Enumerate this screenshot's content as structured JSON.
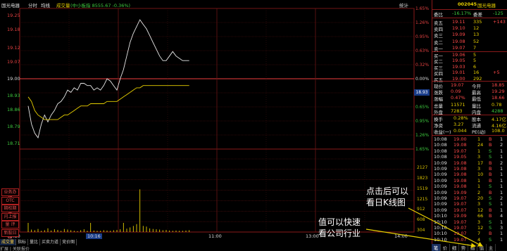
{
  "header": {
    "stock_name": "国光电器",
    "mode": "分时",
    "avg_label": "均线",
    "vol_label": "成交量",
    "index_text": "(中小板指 8555.67 -0.36%)",
    "stats_btn": "统计"
  },
  "price_axis": {
    "labels": [
      "19.25",
      "19.18",
      "19.12",
      "19.07",
      "19.00",
      "18.93",
      "18.86",
      "18.79",
      "18.71"
    ],
    "highlight": "18.93"
  },
  "pct_axis": [
    "1.65%",
    "1.26%",
    "0.95%",
    "0.63%",
    "0.32%",
    "0.00%",
    "0.32%",
    "0.65%",
    "0.95%",
    "1.26%",
    "1.65%"
  ],
  "vol_axis": [
    "2127",
    "1823",
    "1519",
    "1215",
    "912",
    "608",
    "304"
  ],
  "time_axis": [
    "09:30",
    "10:16",
    "11:00",
    "13:00",
    "14:00"
  ],
  "side_buttons": [
    "业务办理",
    "OTC",
    "期权期货",
    "闪上报价",
    "量  评",
    "新股日历"
  ],
  "bottom_tabs": [
    "成交量",
    "指标",
    "量比",
    "买卖力道",
    "竞价图"
  ],
  "bottom_row": "扩展 | 关联报价",
  "chart_data": {
    "type": "line",
    "x": [
      0,
      2,
      4,
      6,
      8,
      10,
      12,
      14,
      16,
      18,
      20,
      22,
      24,
      26,
      28,
      30,
      32,
      34,
      36,
      38,
      40,
      42,
      44,
      46,
      48,
      50,
      52,
      54,
      56,
      58,
      60,
      62,
      64,
      66,
      68,
      70,
      72,
      74,
      76,
      78,
      80,
      82,
      84,
      86,
      88,
      90,
      92,
      94,
      96,
      98
    ],
    "series": [
      {
        "values": [
          18.88,
          18.8,
          18.76,
          18.74,
          18.8,
          18.84,
          18.81,
          18.84,
          18.86,
          18.89,
          18.9,
          18.92,
          18.95,
          18.94,
          18.96,
          18.95,
          18.98,
          18.98,
          18.97,
          18.97,
          18.95,
          18.96,
          18.95,
          18.97,
          19.0,
          18.99,
          18.97,
          18.95,
          19.0,
          19.04,
          19.1,
          19.16,
          19.2,
          19.23,
          19.26,
          19.24,
          19.22,
          19.19,
          19.16,
          19.13,
          19.1,
          19.08,
          19.08,
          19.1,
          19.12,
          19.1,
          19.09,
          19.08,
          19.08,
          19.08
        ]
      },
      {
        "values": [
          18.92,
          18.9,
          18.86,
          18.84,
          18.83,
          18.82,
          18.82,
          18.82,
          18.82,
          18.82,
          18.83,
          18.84,
          18.84,
          18.85,
          18.86,
          18.87,
          18.88,
          18.88,
          18.88,
          18.89,
          18.89,
          18.89,
          18.89,
          18.89,
          18.9,
          18.9,
          18.9,
          18.9,
          18.91,
          18.92,
          18.93,
          18.94,
          18.95,
          18.96,
          18.96,
          18.97,
          18.97,
          18.97,
          18.97,
          18.97,
          18.97,
          18.97,
          18.97,
          18.97,
          18.97,
          18.97,
          18.97,
          18.97,
          18.97,
          18.97
        ]
      }
    ],
    "volume": [
      300,
      80,
      60,
      100,
      40,
      60,
      120,
      50,
      90,
      70,
      40,
      100,
      80,
      60,
      40,
      30,
      60,
      90,
      40,
      300,
      50,
      40,
      40,
      60,
      50,
      40,
      60,
      70,
      90,
      300,
      110,
      150,
      200,
      260,
      1400,
      200,
      180,
      120,
      100,
      90,
      80,
      60,
      70,
      50,
      40,
      50,
      40,
      40,
      50,
      60
    ],
    "ylim": [
      18.69,
      19.31
    ],
    "prev_close": 19.0
  },
  "quote": {
    "code": "002045",
    "name": "国光电器",
    "weibi_label": "委比",
    "weibi": "-16.17%",
    "weicha_label": "委差",
    "weicha": "-125",
    "asks": [
      {
        "label": "卖五",
        "price": "19.11",
        "vol": "335",
        "chg": "+143"
      },
      {
        "label": "卖四",
        "price": "19.10",
        "vol": "12",
        "chg": ""
      },
      {
        "label": "卖三",
        "price": "19.09",
        "vol": "13",
        "chg": ""
      },
      {
        "label": "卖二",
        "price": "19.08",
        "vol": "52",
        "chg": ""
      },
      {
        "label": "卖一",
        "price": "19.07",
        "vol": "7",
        "chg": ""
      }
    ],
    "bids": [
      {
        "label": "买一",
        "price": "19.06",
        "vol": "5",
        "chg": ""
      },
      {
        "label": "买二",
        "price": "19.05",
        "vol": "5",
        "chg": ""
      },
      {
        "label": "买三",
        "price": "19.03",
        "vol": "6",
        "chg": ""
      },
      {
        "label": "买四",
        "price": "19.01",
        "vol": "16",
        "chg": "+5"
      },
      {
        "label": "买五",
        "price": "19.00",
        "vol": "292",
        "chg": ""
      }
    ],
    "stats": [
      {
        "l1": "现价",
        "v1": "19.07",
        "l2": "今开",
        "v2": "18.85"
      },
      {
        "l1": "涨跌",
        "v1": "0.09",
        "l2": "最高",
        "v2": "19.29"
      },
      {
        "l1": "涨幅",
        "v1": "0.47%",
        "l2": "最低",
        "v2": "18.66"
      },
      {
        "l1": "总量",
        "v1": "11571",
        "l2": "量比",
        "v2": "0.78"
      },
      {
        "l1": "外盘",
        "v1": "7283",
        "l2": "内盘",
        "v2": "4288"
      }
    ],
    "stats2": [
      {
        "l1": "换手",
        "v1": "0.28%",
        "l2": "股本",
        "v2": "4.17亿"
      },
      {
        "l1": "净资",
        "v1": "3.27",
        "l2": "流通",
        "v2": "4.16亿"
      },
      {
        "l1": "收益(一)",
        "v1": "0.044",
        "l2": "PE(动)",
        "v2": "108.0"
      }
    ],
    "trades": [
      {
        "t": "10:08",
        "p": "19.00",
        "v": "1",
        "bs": "B",
        "n": "1"
      },
      {
        "t": "10:08",
        "p": "19.08",
        "v": "24",
        "bs": "B",
        "n": "2"
      },
      {
        "t": "10:08",
        "p": "19.07",
        "v": "1",
        "bs": "S",
        "n": "1"
      },
      {
        "t": "10:08",
        "p": "19.05",
        "v": "3",
        "bs": "S",
        "n": "1"
      },
      {
        "t": "10:09",
        "p": "19.08",
        "v": "17",
        "bs": "B",
        "n": "2"
      },
      {
        "t": "10:09",
        "p": "19.08",
        "v": "3",
        "bs": "B",
        "n": "1"
      },
      {
        "t": "10:09",
        "p": "19.08",
        "v": "10",
        "bs": "B",
        "n": "1"
      },
      {
        "t": "10:09",
        "p": "19.08",
        "v": "1",
        "bs": "B",
        "n": "1"
      },
      {
        "t": "10:09",
        "p": "19.08",
        "v": "1",
        "bs": "S",
        "n": "1"
      },
      {
        "t": "10:09",
        "p": "19.09",
        "v": "2",
        "bs": "B",
        "n": "1"
      },
      {
        "t": "10:09",
        "p": "19.07",
        "v": "20",
        "bs": "S",
        "n": "2"
      },
      {
        "t": "10:09",
        "p": "19.07",
        "v": "3",
        "bs": "S",
        "n": "1"
      },
      {
        "t": "10:09",
        "p": "19.07",
        "v": "12",
        "bs": "B",
        "n": "1"
      },
      {
        "t": "10:10",
        "p": "19.09",
        "v": "66",
        "bs": "B",
        "n": "4"
      },
      {
        "t": "10:10",
        "p": "19.07",
        "v": "3",
        "bs": "S",
        "n": "1"
      },
      {
        "t": "10:10",
        "p": "19.07",
        "v": "12",
        "bs": "S",
        "n": "3"
      },
      {
        "t": "10:10",
        "p": "19.07",
        "v": "7",
        "bs": "B",
        "n": "1"
      },
      {
        "t": "10:10",
        "p": "19.07",
        "v": "4",
        "bs": "S",
        "n": "1"
      }
    ]
  },
  "right_tabs": [
    "笔",
    "价",
    "细",
    "势",
    "指",
    "值",
    "主"
  ],
  "annotations": {
    "a1_line1": "点击后可以",
    "a1_line2": "看日K线图",
    "a2_line1": "值可以快速",
    "a2_line2": "看公司行业"
  }
}
